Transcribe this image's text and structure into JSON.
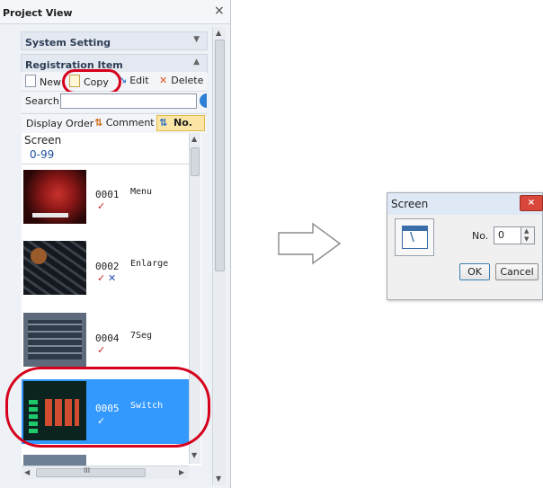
{
  "project_view": {
    "title": "Project View",
    "close_glyph": "×",
    "system_setting": "System Setting",
    "registration_item": "Registration Item",
    "toolbar": {
      "new_label": "New",
      "copy_label": "Copy",
      "edit_label": "Edit",
      "delete_label": "Delete"
    },
    "search_label": "Search",
    "search_value": "",
    "display_order_label": "Display Order",
    "comment_label": "Comment",
    "no_label": "No.",
    "screen_header": "Screen",
    "range": "0-99",
    "items": [
      {
        "no": "0001",
        "name": "Menu",
        "status": "check",
        "selected": false
      },
      {
        "no": "0002",
        "name": "Enlarge",
        "status": "check-cross",
        "selected": false
      },
      {
        "no": "0004",
        "name": "7Seg",
        "status": "check",
        "selected": false
      },
      {
        "no": "0005",
        "name": "Switch",
        "status": "check",
        "selected": true
      }
    ],
    "hscroll_glyph": "III"
  },
  "arrow_icon": "right-arrow-icon",
  "dialog": {
    "title": "Screen",
    "close_glyph": "×",
    "no_label": "No.",
    "no_value": "0",
    "ok_label": "OK",
    "cancel_label": "Cancel"
  },
  "colors": {
    "highlight_ring": "#d6001c",
    "selection": "#3399ff",
    "dialog_title": "#dfe9f5"
  }
}
